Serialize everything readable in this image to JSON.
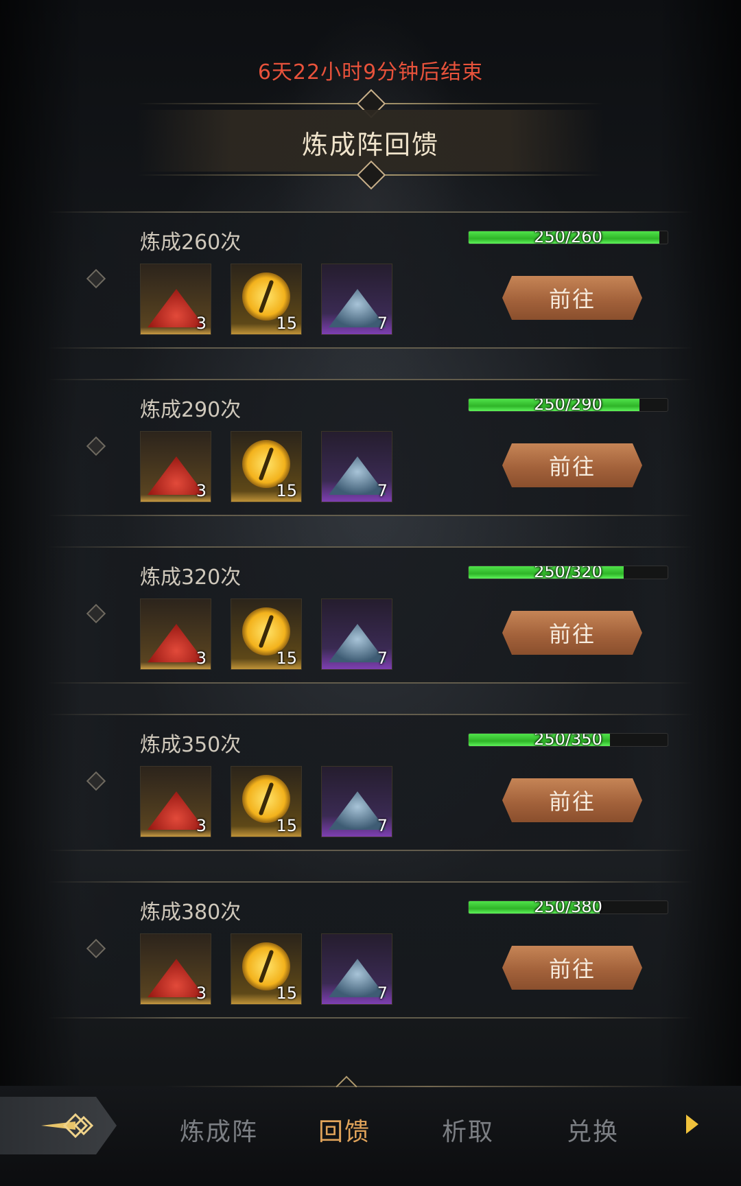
{
  "timer_text": "6天22小时9分钟后结束",
  "title": "炼成阵回馈",
  "go_label": "前往",
  "rows": [
    {
      "title": "炼成260次",
      "progress_text": "250/260",
      "progress": 0.96,
      "items": [
        "3",
        "15",
        "7"
      ]
    },
    {
      "title": "炼成290次",
      "progress_text": "250/290",
      "progress": 0.86,
      "items": [
        "3",
        "15",
        "7"
      ]
    },
    {
      "title": "炼成320次",
      "progress_text": "250/320",
      "progress": 0.78,
      "items": [
        "3",
        "15",
        "7"
      ]
    },
    {
      "title": "炼成350次",
      "progress_text": "250/350",
      "progress": 0.71,
      "items": [
        "3",
        "15",
        "7"
      ]
    },
    {
      "title": "炼成380次",
      "progress_text": "250/380",
      "progress": 0.66,
      "items": [
        "3",
        "15",
        "7"
      ]
    }
  ],
  "nav": {
    "tabs": [
      "炼成阵",
      "回馈",
      "析取",
      "兑换"
    ],
    "active": "回馈"
  },
  "colors": {
    "timer": "#e8523b",
    "progress": "#3fd43a",
    "button": "#b06d42",
    "active_tab": "#e0a35a"
  }
}
